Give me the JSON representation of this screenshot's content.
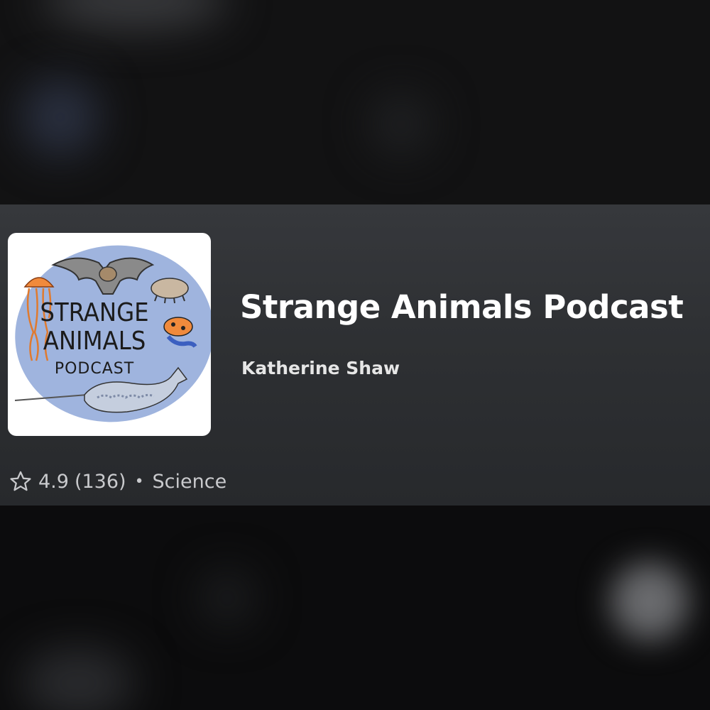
{
  "podcast": {
    "title": "Strange Animals Podcast",
    "author": "Katherine Shaw",
    "rating": "4.9",
    "rating_count": "(136)",
    "separator": "•",
    "category": "Science",
    "artwork": {
      "line1": "STRANGE",
      "line2": "ANIMALS",
      "line3": "PODCAST"
    }
  },
  "icons": {
    "rating": "star-outline-icon"
  },
  "colors": {
    "card_background": "#2e3033",
    "artwork_circle": "#9fb4de",
    "title_text": "#ffffff",
    "secondary_text": "#c9cacd"
  }
}
